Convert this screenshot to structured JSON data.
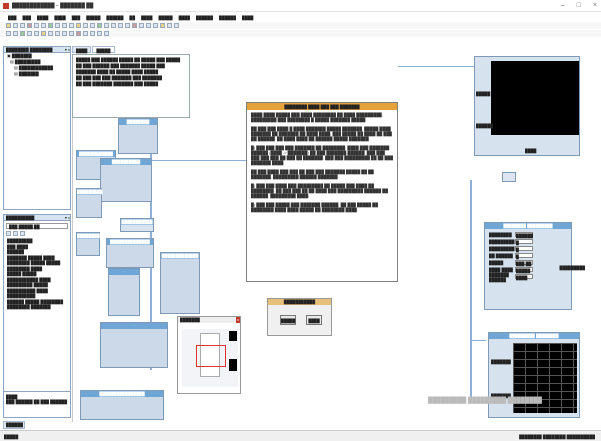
{
  "window": {
    "title": "████████████ – ███████ ██",
    "minimize": "–",
    "maximize": "□",
    "close": "×"
  },
  "menu": [
    "███",
    "███",
    "████",
    "████",
    "███",
    "█████",
    "██████",
    "██",
    "████",
    "█████",
    "████",
    "██████",
    "██████",
    "████"
  ],
  "tabs": [
    "████",
    "█████"
  ],
  "program_explorer": {
    "title": "████████ ████████",
    "items": [
      "███████",
      "█████████",
      "████████████",
      "███████"
    ]
  },
  "properties": {
    "title": "██████████",
    "selector": "███ █████ ██",
    "rows": [
      "█████████",
      "███ ████",
      "██████",
      "███████ █████ ████",
      "████████ █████ █████",
      "████████ ████",
      "█████ █████",
      "███████████ ████",
      "█████████ █████",
      "██████████ ████",
      "██████████",
      "██████ █████ ████████",
      "████████ ███████"
    ],
    "footer_title": "████",
    "footer_desc": "███ ██████ ██ ███ ██████"
  },
  "info_box": {
    "title": "████████ ████ ███ ███ ███████",
    "para1": "████ ████ █████ ███ ████ ████████ ██ ████ █████████, █████████ ███ ████████ █ █████ ███████ █████.",
    "para2": "██ ███ ███ ████ █ ████ ███████ █████ ███████, █████ ████ ███████ ██ ███████ ██ ████ ████, ███ █████ ██ ████ ██ ███ ██ ██████. ██ ████ ████ ██ ██████ █████ ███████.",
    "para3": "█) ███ ███ ███ ███ ███████ ██ ████████. ████ ███ ███████ ██████ (████ -> ███████) ██ ███ ███████-██████, ███ ███ ███ ███ ███ ██ ███ ██ ███████, ███ ███ █████████ ██ ██ ███ ███████ ████.",
    "para4": "██ ███ ████ ███ ███ ██ ███ ███ ███████ █████ ██ ██ ███████, █████████ ██████ ███████.",
    "para5": "█) ███ ███ ████ ███ █████████ ██ █████ ███ ████ ██ ████████. ██ ███ ███ ██ ██ ████ ███ █████████ ██████ ██ ██████, █████████ ████.",
    "para6": "█) ███ ███ █████ ███ ███████ ██████, ██ ███ █████ ██ ████████ ████ ████ █████ ██ ████████ ████."
  },
  "canvas_nodes": [
    "████████",
    "████████████",
    "██████████",
    "█████████",
    "███████████",
    "████████",
    "██████████████",
    "█████████████",
    "████████████████"
  ],
  "button_panel": {
    "title": "███████████",
    "btn1": "█████",
    "btn2": "████"
  },
  "minimap_title": "███████",
  "top_graph": {
    "y_label": "█████",
    "y_label2": "██████",
    "x_label": "████"
  },
  "function_generator": {
    "title": "████████ █████████",
    "rows": [
      {
        "label": "████████",
        "value": "██████"
      },
      {
        "label": "█████████",
        "value": "█"
      },
      {
        "label": "█████████",
        "value": "█"
      },
      {
        "label": "██ ██████",
        "value": "█"
      },
      {
        "label": "█████",
        "value": "███ ██"
      },
      {
        "label": "████ ████",
        "value": "█████"
      },
      {
        "label": "███████ ██████",
        "value": "████"
      }
    ],
    "side_label": "█████████"
  },
  "bottom_graph": {
    "title": "█████████ ████████",
    "y_label": "███████",
    "y_label2": "███████"
  },
  "watermark": "█████████ █████████ ████████",
  "status": {
    "left": "█████",
    "right": "████████ ████████ ██████████",
    "bottom_tab": "██████"
  }
}
